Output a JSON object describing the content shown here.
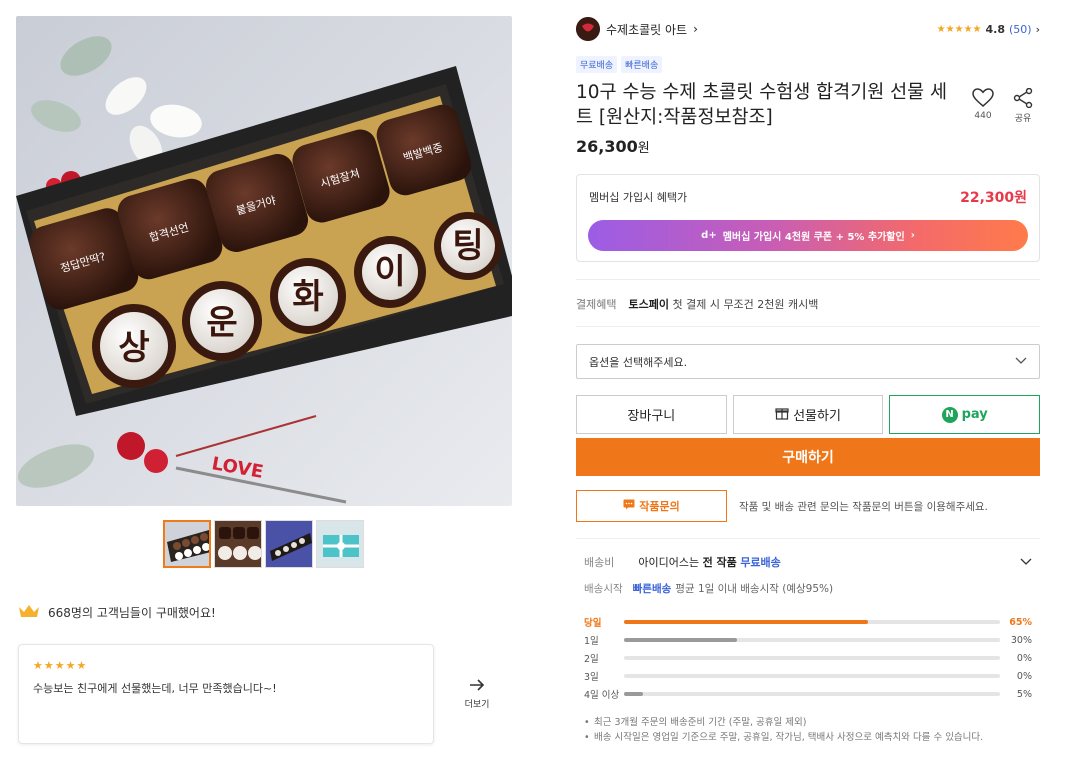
{
  "gallery": {
    "main_image_alt": "chocolate gift box",
    "main_pieces_top": [
      "정답만딱?",
      "합격선언",
      "붙을거야",
      "시험잘쳐",
      "백발백중"
    ],
    "main_pieces_bottom": [
      "상",
      "운",
      "화",
      "이",
      "팅"
    ],
    "thumbs": [
      "thumb-1",
      "thumb-2",
      "thumb-3",
      "thumb-4"
    ],
    "love_tag": "LOVE"
  },
  "buyers": {
    "text": "668명의 고객님들이 구매했어요!"
  },
  "review": {
    "stars": "★★★★★",
    "text": "수능보는 친구에게 선물했는데, 너무 만족했습니다~!"
  },
  "more": {
    "label": "더보기"
  },
  "shop": {
    "name": "수제초콜릿 아트",
    "chevron": "›"
  },
  "rating": {
    "stars": "★★★★★",
    "score": "4.8",
    "count": "(50)",
    "chevron": "›"
  },
  "badges": [
    "무료배송",
    "빠른배송"
  ],
  "product": {
    "title": "10구 수능 수제 초콜릿 수험생 합격기원 선물 세트 [원산지:작품정보참조]",
    "price": "26,300",
    "price_unit": "원"
  },
  "like": {
    "count": "440"
  },
  "share": {
    "label": "공유"
  },
  "member": {
    "label": "멤버십 가입시 혜택가",
    "price": "22,300원",
    "cta_logo": "d+",
    "cta_text": "멤버십 가입시  4천원 쿠폰 + 5% 추가할인",
    "cta_chevron": "›"
  },
  "payment": {
    "label": "결제혜택",
    "brand": "토스페이",
    "text": "첫 결제 시 무조건 2천원 캐시백"
  },
  "option_select": {
    "placeholder": "옵션을 선택해주세요."
  },
  "buttons": {
    "cart": "장바구니",
    "gift": "선물하기",
    "npay_logo": "N",
    "npay": "pay",
    "buy": "구매하기",
    "qna": "작품문의"
  },
  "qna_note": "작품 및 배송 관련 문의는 작품문의 버튼을 이용해주세요.",
  "shipping": {
    "label": "배송비",
    "prefix": "아이디어스는",
    "strong": "전 작품",
    "free": "무료배송",
    "start_label": "배송시작",
    "fast": "빠른배송",
    "start_text": "평균 1일 이내 배송시작 (예상95%)"
  },
  "ship_stats": [
    {
      "label": "당일",
      "pct": "65%",
      "value": 65,
      "top": true
    },
    {
      "label": "1일",
      "pct": "30%",
      "value": 30,
      "top": false
    },
    {
      "label": "2일",
      "pct": "0%",
      "value": 0,
      "top": false
    },
    {
      "label": "3일",
      "pct": "0%",
      "value": 0,
      "top": false
    },
    {
      "label": "4일 이상",
      "pct": "5%",
      "value": 5,
      "top": false
    }
  ],
  "notes": [
    "최근 3개월 주문의 배송준비 기간 (주말, 공휴일 제외)",
    "배송 시작일은 영업일 기준으로 주말, 공휴일, 작가님, 택배사 사정으로 예측치와 다를 수 있습니다."
  ],
  "colors": {
    "accent": "#ef7719",
    "blue": "#3c64d8",
    "member_price": "#e8394a",
    "npay": "#1fa55b"
  }
}
